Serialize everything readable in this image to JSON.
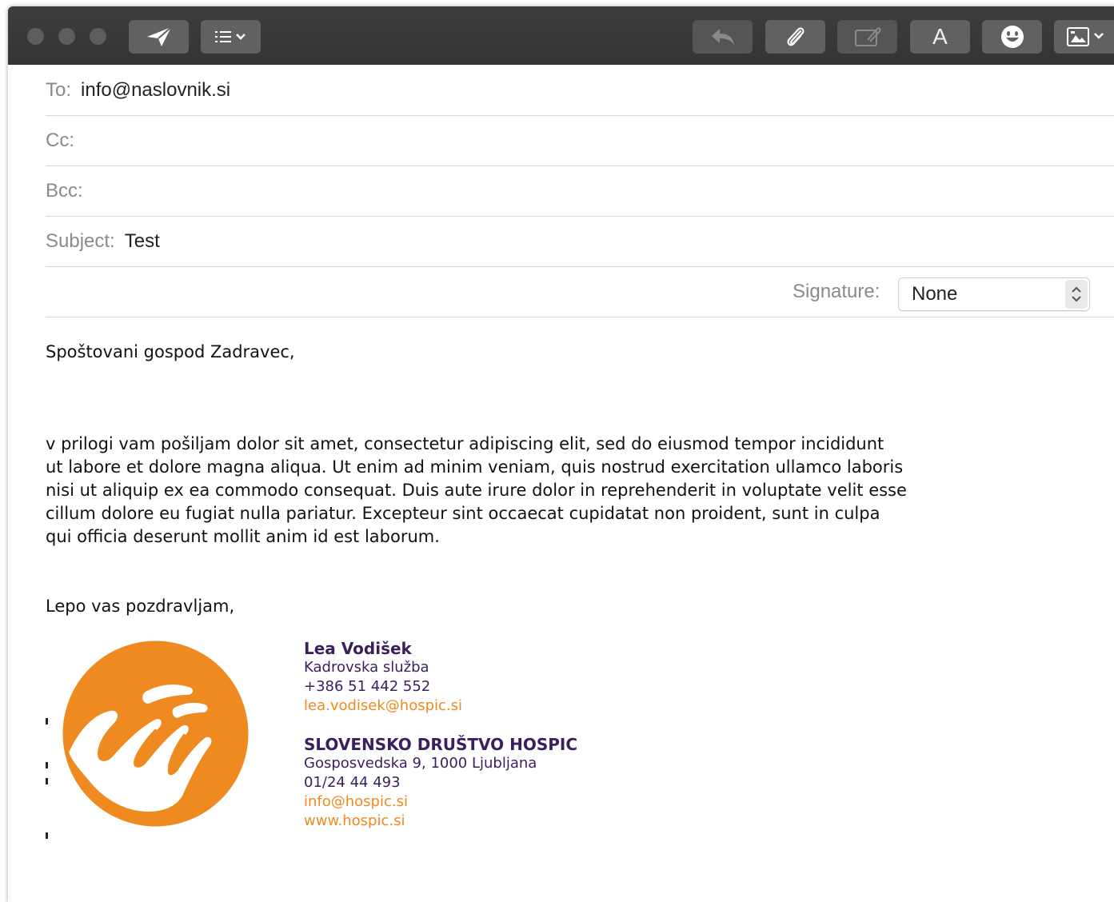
{
  "header": {
    "to_label": "To:",
    "to_value": "info@naslovnik.si",
    "cc_label": "Cc:",
    "cc_value": "",
    "bcc_label": "Bcc:",
    "bcc_value": "",
    "subject_label": "Subject:",
    "subject_value": "Test",
    "signature_label": "Signature:",
    "signature_value": "None"
  },
  "toolbar": {
    "icons": [
      "send-icon",
      "list-format-icon",
      "reply-icon",
      "attachment-icon",
      "markup-icon",
      "font-icon",
      "emoji-icon",
      "photo-browser-icon"
    ],
    "font_letter": "A"
  },
  "body": {
    "greeting": "Spoštovani gospod Zadravec,",
    "paragraph": "v prilogi vam pošiljam dolor sit amet, consectetur adipiscing elit, sed do eiusmod tempor incididunt\nut labore et dolore magna aliqua. Ut enim ad minim veniam, quis nostrud exercitation ullamco laboris\nnisi ut aliquip ex ea commodo consequat. Duis aute irure dolor in reprehenderit in voluptate velit esse\ncillum dolore eu fugiat nulla pariatur. Excepteur sint occaecat cupidatat non proident, sunt in culpa\nqui officia deserunt mollit anim id est laborum.",
    "closing": "Lepo vas pozdravljam,"
  },
  "signature": {
    "name": "Lea Vodišek",
    "department": "Kadrovska služba",
    "phone": "+386 51 442 552",
    "email": "lea.vodisek@hospic.si",
    "org": "SLOVENSKO DRUŠTVO HOSPIC",
    "address": "Gosposvedska 9, 1000 Ljubljana",
    "org_phone": "01/24 44 493",
    "org_email": "info@hospic.si",
    "web": "www.hospic.si"
  },
  "colors": {
    "brand_orange": "#ee8a1f",
    "brand_purple": "#3a1f5c"
  }
}
